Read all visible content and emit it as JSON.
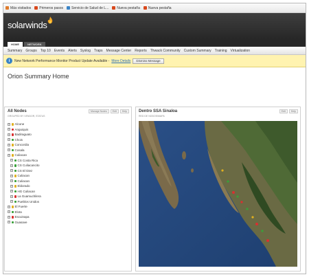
{
  "bookmarks": [
    {
      "label": "Más visitados",
      "color": "#e07b2b"
    },
    {
      "label": "Primeros pasos",
      "color": "#d9481c"
    },
    {
      "label": "Servicio de Salud de L...",
      "color": "#3a84c6"
    },
    {
      "label": "Nueva pestaña",
      "color": "#d9481c"
    },
    {
      "label": "Nueva pestaña",
      "color": "#d9481c"
    }
  ],
  "brand": {
    "logo_text": "solarwinds",
    "accent": "#f5a623"
  },
  "tabs": [
    "HOME",
    "NETWORK"
  ],
  "menu": [
    "Summary",
    "Groups",
    "Top 10",
    "Events",
    "Alerts",
    "Syslog",
    "Traps",
    "Message Center",
    "Reports",
    "Thwack Community",
    "Custom Summary",
    "Training",
    "Virtualization"
  ],
  "notification": {
    "text": "New Network Performance Monitor Product Update Available -",
    "link": "More Details",
    "button": "Dismiss Message"
  },
  "page_title": "Orion Summary Home",
  "left_panel": {
    "title": "All Nodes",
    "subtitle": "Grouped by Vendor, Status",
    "buttons": [
      "Manage Nodes",
      "Edit",
      "Help"
    ],
    "tree": [
      {
        "label": "Alcone",
        "level": 0,
        "status": "#e0b020"
      },
      {
        "label": "Anguiquis",
        "level": 0,
        "status": "#d93030"
      },
      {
        "label": "Badiraguato",
        "level": 0,
        "status": "#d93030"
      },
      {
        "label": "Chois",
        "level": 0,
        "status": "#3aa03a"
      },
      {
        "label": "Concordia",
        "level": 0,
        "status": "#e0b020"
      },
      {
        "label": "Cosala",
        "level": 0,
        "status": "#3aa03a"
      },
      {
        "label": "Culiacan",
        "level": 0,
        "status": "#e0b020"
      },
      {
        "label": "CS Costa Rica",
        "level": 1,
        "status": "#3aa03a"
      },
      {
        "label": "CS Culiacancito",
        "level": 1,
        "status": "#3aa03a"
      },
      {
        "label": "CS El Diez",
        "level": 1,
        "status": "#3aa03a"
      },
      {
        "label": "Culiacan",
        "level": 1,
        "status": "#e0b020"
      },
      {
        "label": "Culiacan",
        "level": 1,
        "status": "#3aa03a"
      },
      {
        "label": "Eldorado",
        "level": 1,
        "status": "#e0b020"
      },
      {
        "label": "HG Culiacan",
        "level": 1,
        "status": "#3aa03a"
      },
      {
        "label": "La Guamuchilera",
        "level": 1,
        "status": "#d93030"
      },
      {
        "label": "Pueblos Unidos",
        "level": 1,
        "status": "#3aa03a"
      },
      {
        "label": "El Fuerte",
        "level": 0,
        "status": "#e0b020"
      },
      {
        "label": "Elota",
        "level": 0,
        "status": "#3aa03a"
      },
      {
        "label": "Escuinapa",
        "level": 0,
        "status": "#d93030"
      },
      {
        "label": "Guasave",
        "level": 0,
        "status": "#3aa03a"
      }
    ]
  },
  "right_panel": {
    "title": "Dentro SSA Sinaloa",
    "subtitle": "Red de Nodos/Mapa",
    "buttons": [
      "Edit",
      "Help"
    ]
  }
}
